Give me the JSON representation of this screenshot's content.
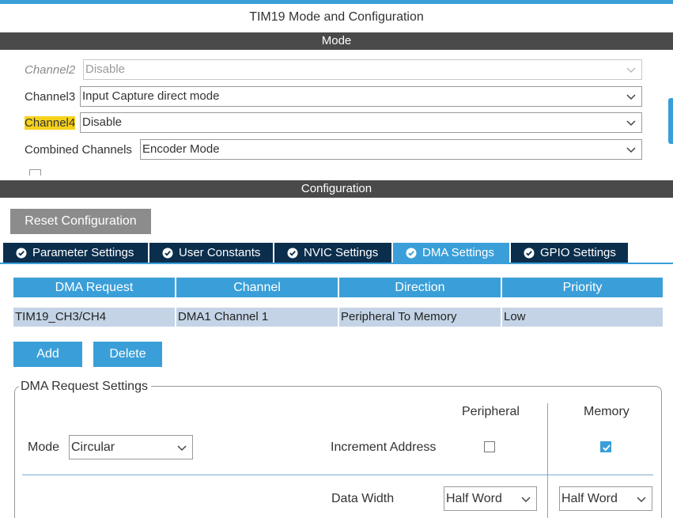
{
  "window": {
    "title": "TIM19 Mode and Configuration"
  },
  "mode_section": {
    "title": "Mode",
    "channel2": {
      "label": "Channel2",
      "value": "Disable"
    },
    "channel3": {
      "label": "Channel3",
      "value": "Input Capture direct mode"
    },
    "channel4": {
      "label": "Channel4",
      "value": "Disable"
    },
    "combined": {
      "label": "Combined Channels",
      "value": "Encoder Mode"
    }
  },
  "config_section": {
    "title": "Configuration",
    "reset_label": "Reset Configuration"
  },
  "tabs": [
    {
      "label": "Parameter Settings"
    },
    {
      "label": "User Constants"
    },
    {
      "label": "NVIC Settings"
    },
    {
      "label": "DMA Settings"
    },
    {
      "label": "GPIO Settings"
    }
  ],
  "dma_table": {
    "headers": [
      "DMA Request",
      "Channel",
      "Direction",
      "Priority"
    ],
    "rows": [
      [
        "TIM19_CH3/CH4",
        "DMA1 Channel 1",
        "Peripheral To Memory",
        "Low"
      ]
    ]
  },
  "buttons": {
    "add": "Add",
    "delete": "Delete"
  },
  "dma_request_settings": {
    "legend": "DMA Request Settings",
    "peripheral_header": "Peripheral",
    "memory_header": "Memory",
    "mode_label": "Mode",
    "mode_value": "Circular",
    "increment_label": "Increment Address",
    "peripheral_increment": false,
    "memory_increment": true,
    "data_width_label": "Data Width",
    "peripheral_width": "Half Word",
    "memory_width": "Half Word"
  },
  "colors": {
    "accent": "#3a9fd8",
    "section_bar": "#4a4a4a",
    "tab_dark": "#0b2e4d",
    "highlight": "#f7d21b",
    "selected_row": "#c4d4e6"
  },
  "icons": {
    "dropdown": "chevron-down-icon",
    "tab_status": "check-circle-icon",
    "checkbox_checked": "checkmark-icon"
  }
}
